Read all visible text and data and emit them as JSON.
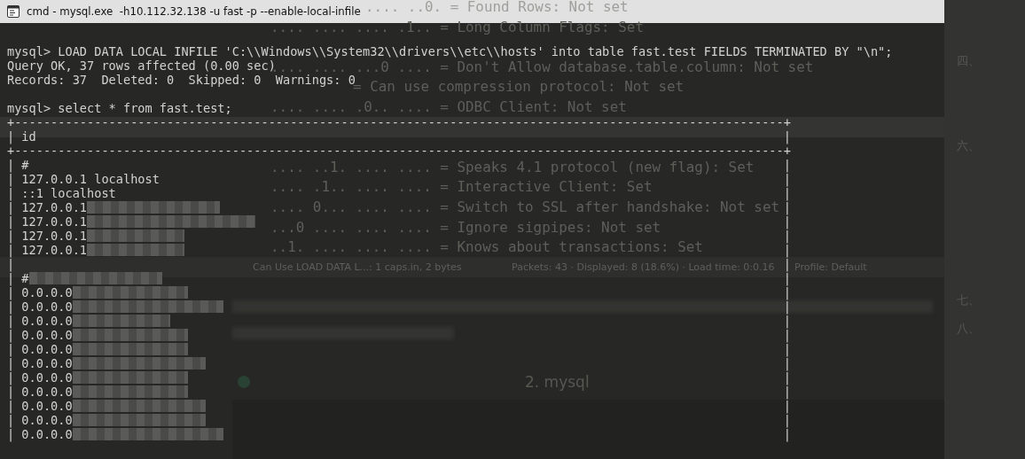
{
  "background": {
    "packet_details": [
      {
        "text": ".... ..0. = Found Rows: Not set",
        "selected": false
      },
      {
        "text": ".... .... .... .1.. = Long Column Flags: Set",
        "selected": false
      },
      {
        "text": ".... .... ...0 .... = Don't Allow database.table.column: Not set",
        "selected": false
      },
      {
        "text": "= Can use compression protocol: Not set",
        "selected": false
      },
      {
        "text": ".... .... .0.. .... = ODBC Client: Not set",
        "selected": false
      },
      {
        "selected": true
      },
      {
        "text": ".... ..1. .... .... = Speaks 4.1 protocol (new flag): Set",
        "selected": false
      },
      {
        "text": ".... .1.. .... .... = Interactive Client: Set",
        "selected": false
      },
      {
        "text": ".... 0... .... .... = Switch to SSL after handshake: Not set",
        "selected": false
      },
      {
        "text": "...0 .... .... .... = Ignore sigpipes: Not set",
        "selected": false
      },
      {
        "text": "..1. .... .... .... = Knows about transactions: Set",
        "selected": false
      }
    ],
    "status_bar": [
      "Can Use LOAD DATA L...: 1 caps.in, 2 bytes",
      "Packets: 43 · Displayed: 8 (18.6%) · Load time: 0:0.16",
      "Profile: Default"
    ],
    "heading": "2. mysql",
    "outline": [
      "四、",
      "六、",
      "七、",
      "八、"
    ]
  },
  "window": {
    "title": "cmd - mysql.exe  -h10.112.32.138 -u fast -p --enable-local-infile"
  },
  "terminal": [
    {
      "kind": "blank"
    },
    {
      "kind": "text",
      "text": "mysql> LOAD DATA LOCAL INFILE 'C:\\\\Windows\\\\System32\\\\drivers\\\\etc\\\\hosts' into table fast.test FIELDS TERMINATED BY \"\\n\";"
    },
    {
      "kind": "text",
      "text": "Query OK, 37 rows affected (0.00 sec)"
    },
    {
      "kind": "text",
      "text": "Records: 37  Deleted: 0  Skipped: 0  Warnings: 0"
    },
    {
      "kind": "blank"
    },
    {
      "kind": "text",
      "text": "mysql> select * from fast.test;"
    },
    {
      "kind": "border",
      "text": "+----------------------------------------------------------------------------------------------------------+"
    },
    {
      "kind": "row",
      "text": "| id",
      "end": "|",
      "redacted": false
    },
    {
      "kind": "border",
      "text": "+----------------------------------------------------------------------------------------------------------+"
    },
    {
      "kind": "row",
      "text": "| #",
      "end": "|",
      "redacted": false
    },
    {
      "kind": "row",
      "text": "| 127.0.0.1 localhost",
      "end": "|",
      "redacted": false
    },
    {
      "kind": "row",
      "text": "| ::1 localhost",
      "end": "|",
      "redacted": false
    },
    {
      "kind": "row",
      "text": "| 127.0.0.1",
      "end": "|",
      "redacted": true
    },
    {
      "kind": "row",
      "text": "| 127.0.0.1",
      "end": "|",
      "redacted": true
    },
    {
      "kind": "row",
      "text": "| 127.0.0.1",
      "end": "|",
      "redacted": true
    },
    {
      "kind": "row",
      "text": "| 127.0.0.1",
      "end": "|",
      "redacted": true
    },
    {
      "kind": "row",
      "text": "|",
      "end": "|",
      "redacted": false
    },
    {
      "kind": "row",
      "text": "| #",
      "end": "|",
      "redacted": true
    },
    {
      "kind": "row",
      "text": "| 0.0.0.0",
      "end": "|",
      "redacted": true
    },
    {
      "kind": "row",
      "text": "| 0.0.0.0",
      "end": "|",
      "redacted": true
    },
    {
      "kind": "row",
      "text": "| 0.0.0.0",
      "end": "|",
      "redacted": true
    },
    {
      "kind": "row",
      "text": "| 0.0.0.0",
      "end": "|",
      "redacted": true
    },
    {
      "kind": "row",
      "text": "| 0.0.0.0",
      "end": "|",
      "redacted": true
    },
    {
      "kind": "row",
      "text": "| 0.0.0.0",
      "end": "|",
      "redacted": true
    },
    {
      "kind": "row",
      "text": "| 0.0.0.0",
      "end": "|",
      "redacted": true
    },
    {
      "kind": "row",
      "text": "| 0.0.0.0",
      "end": "|",
      "redacted": true
    },
    {
      "kind": "row",
      "text": "| 0.0.0.0",
      "end": "|",
      "redacted": true
    },
    {
      "kind": "row",
      "text": "| 0.0.0.0",
      "end": "|",
      "redacted": true
    },
    {
      "kind": "row",
      "text": "| 0.0.0.0",
      "end": "|",
      "redacted": true
    }
  ]
}
